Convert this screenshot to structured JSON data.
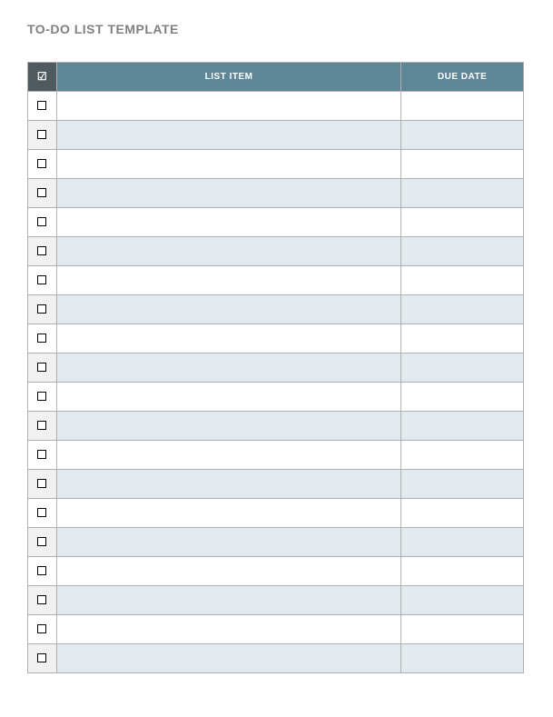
{
  "title": "TO-DO LIST TEMPLATE",
  "headers": {
    "check": "☑",
    "item": "LIST ITEM",
    "due": "DUE DATE"
  },
  "rows": [
    {
      "checked": false,
      "item": "",
      "due": ""
    },
    {
      "checked": false,
      "item": "",
      "due": ""
    },
    {
      "checked": false,
      "item": "",
      "due": ""
    },
    {
      "checked": false,
      "item": "",
      "due": ""
    },
    {
      "checked": false,
      "item": "",
      "due": ""
    },
    {
      "checked": false,
      "item": "",
      "due": ""
    },
    {
      "checked": false,
      "item": "",
      "due": ""
    },
    {
      "checked": false,
      "item": "",
      "due": ""
    },
    {
      "checked": false,
      "item": "",
      "due": ""
    },
    {
      "checked": false,
      "item": "",
      "due": ""
    },
    {
      "checked": false,
      "item": "",
      "due": ""
    },
    {
      "checked": false,
      "item": "",
      "due": ""
    },
    {
      "checked": false,
      "item": "",
      "due": ""
    },
    {
      "checked": false,
      "item": "",
      "due": ""
    },
    {
      "checked": false,
      "item": "",
      "due": ""
    },
    {
      "checked": false,
      "item": "",
      "due": ""
    },
    {
      "checked": false,
      "item": "",
      "due": ""
    },
    {
      "checked": false,
      "item": "",
      "due": ""
    },
    {
      "checked": false,
      "item": "",
      "due": ""
    },
    {
      "checked": false,
      "item": "",
      "due": ""
    }
  ]
}
